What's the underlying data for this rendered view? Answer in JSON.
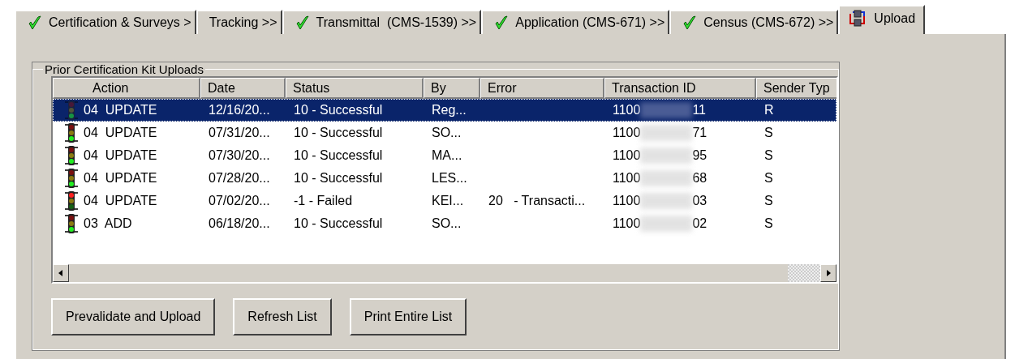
{
  "tabs": [
    {
      "label": "Certification & Surveys >",
      "kind": "check",
      "selected": false
    },
    {
      "label": "Tracking >>",
      "kind": "plain",
      "selected": false
    },
    {
      "label": "Transmittal  (CMS-1539) >>",
      "kind": "check",
      "selected": false
    },
    {
      "label": "Application (CMS-671) >>",
      "kind": "check",
      "selected": false
    },
    {
      "label": "Census (CMS-672) >>",
      "kind": "check",
      "selected": false
    },
    {
      "label": "Upload",
      "kind": "upload",
      "selected": true
    }
  ],
  "group": {
    "title": "Prior Certification Kit Uploads"
  },
  "table": {
    "columns": [
      "Action",
      "Date",
      "Status",
      "By",
      "Error",
      "Transaction ID",
      "Sender Typ"
    ],
    "rows": [
      {
        "selected": true,
        "kind": "success",
        "action": "04  UPDATE",
        "date": "12/16/20...",
        "status": "10 - Successful",
        "by": "Reg...",
        "error": "",
        "id_start": "1100",
        "id_end": "11",
        "sender": "R"
      },
      {
        "selected": false,
        "kind": "success",
        "action": "04  UPDATE",
        "date": "07/31/20...",
        "status": "10 - Successful",
        "by": "SO...",
        "error": "",
        "id_start": "1100",
        "id_end": "71",
        "sender": "S"
      },
      {
        "selected": false,
        "kind": "success",
        "action": "04  UPDATE",
        "date": "07/30/20...",
        "status": "10 - Successful",
        "by": "MA...",
        "error": "",
        "id_start": "1100",
        "id_end": "95",
        "sender": "S"
      },
      {
        "selected": false,
        "kind": "success",
        "action": "04  UPDATE",
        "date": "07/28/20...",
        "status": "10 - Successful",
        "by": "LES...",
        "error": "",
        "id_start": "1100",
        "id_end": "68",
        "sender": "S"
      },
      {
        "selected": false,
        "kind": "failed",
        "action": "04  UPDATE",
        "date": "07/02/20...",
        "status": "-1 - Failed",
        "by": "KEI...",
        "error": "20   - Transacti...",
        "id_start": "1100",
        "id_end": "03",
        "sender": "S"
      },
      {
        "selected": false,
        "kind": "success",
        "action": "03  ADD",
        "date": "06/18/20...",
        "status": "10 - Successful",
        "by": "SO...",
        "error": "",
        "id_start": "1100",
        "id_end": "02",
        "sender": "S"
      }
    ]
  },
  "buttons": [
    "Prevalidate and Upload",
    "Refresh List",
    "Print Entire List"
  ]
}
